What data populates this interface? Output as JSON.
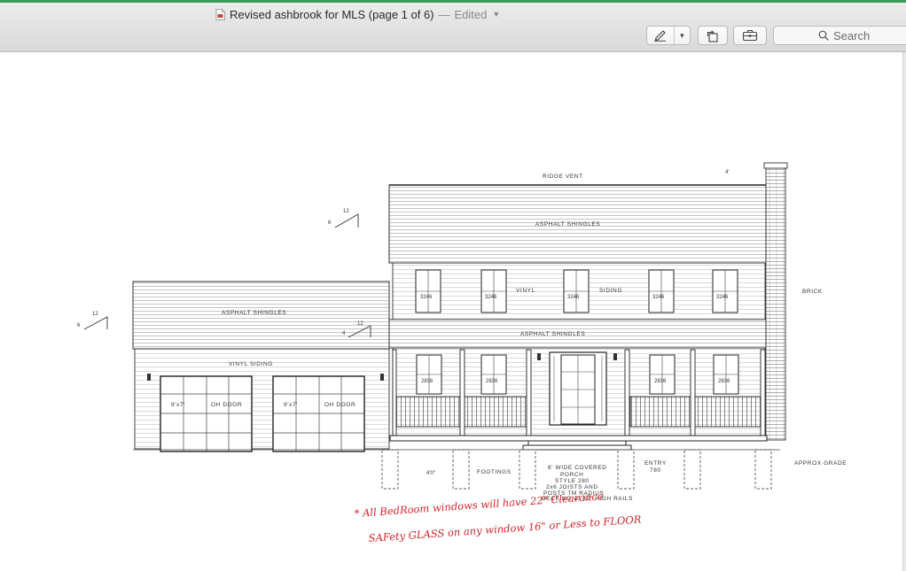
{
  "window": {
    "title": "Revised ashbrook for MLS (page 1 of 6)",
    "title_separator": "—",
    "edited_label": "Edited",
    "accent_color": "#3b9b58"
  },
  "toolbar": {
    "markup_icon": "pen-markup-icon",
    "markup_menu_icon": "chevron-down-icon",
    "rotate_icon": "rotate-left-icon",
    "toolbox_icon": "toolbox-icon",
    "search_placeholder": "Search",
    "search_value": ""
  },
  "document": {
    "labels": {
      "ridge_vent": "RIDGE VENT",
      "roof_upper": "ASPHALT SHINGLES",
      "roof_porch": "ASPHALT SHINGLES",
      "roof_garage": "ASPHALT SHINGLES",
      "siding_upper": "VINYL",
      "siding_upper_right": "SIDING",
      "siding_garage": "VINYL SIDING",
      "brick": "BRICK",
      "footings": "FOOTINGS",
      "porch_note_1": "6' WIDE COVERED",
      "porch_note_2": "PORCH",
      "porch_note_3": "STYLE 280",
      "porch_note_4": "2x6 JOISTS AND",
      "porch_note_5": "POSTS TM RADIUS",
      "porch_note_6": "DECKING w/ 42\" HIGH RAILS",
      "entry": "ENTRY",
      "entry_code": "780",
      "approx_grade": "APPROX GRADE",
      "garage_door_left_size": "9'x7'",
      "garage_door_left_type": "OH DOOR",
      "garage_door_right_size": "9'x7'",
      "garage_door_right_type": "OH DOOR",
      "window_code_upper": "3246",
      "window_code_lower": "2836",
      "pitch_rise": "12",
      "pitch_run": "6",
      "pitch_rise_porch": "12",
      "pitch_run_porch": "4",
      "chimney_dim": "4'",
      "footing_dim": "4'0\""
    },
    "handwritten_notes": [
      "* All BedRoom windows will have 22\" Clearance",
      "SAFety GLASS on any window 16\" or Less to FLOOR"
    ],
    "note_color": "#d2232a"
  }
}
